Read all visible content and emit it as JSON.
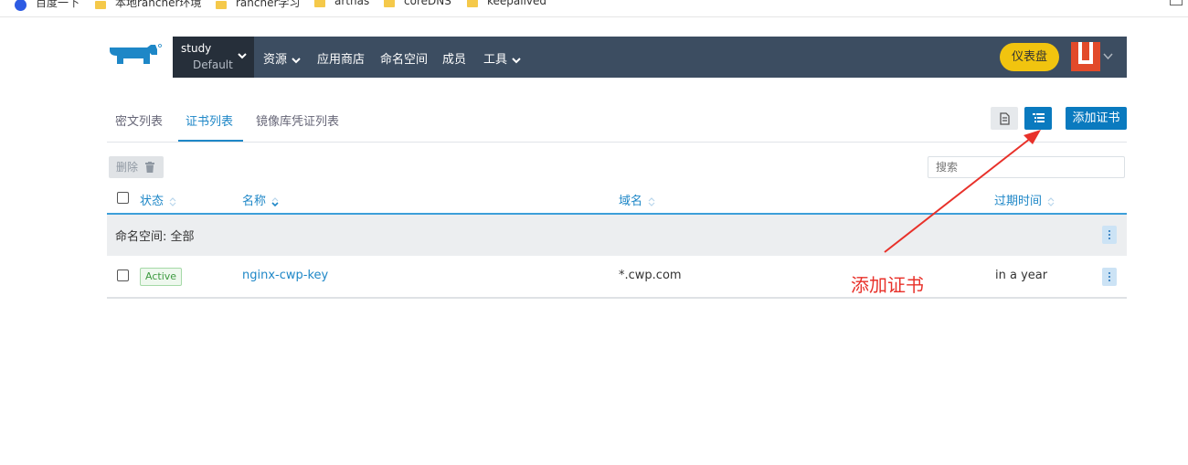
{
  "bookmarks": [
    {
      "label": "百度一下",
      "icon": "baidu-icon"
    },
    {
      "label": "本地rancher环境",
      "icon": "folder-icon"
    },
    {
      "label": "rancher学习",
      "icon": "folder-icon"
    },
    {
      "label": "arthas",
      "icon": "folder-icon"
    },
    {
      "label": "coreDNS",
      "icon": "folder-icon"
    },
    {
      "label": "keepalived",
      "icon": "folder-icon"
    }
  ],
  "nav": {
    "project_name": "study",
    "cluster_name": "Default",
    "items": [
      {
        "label": "资源",
        "has_dropdown": true
      },
      {
        "label": "应用商店",
        "has_dropdown": false
      },
      {
        "label": "命名空间",
        "has_dropdown": false
      },
      {
        "label": "成员",
        "has_dropdown": false
      },
      {
        "label": "工具",
        "has_dropdown": true
      }
    ],
    "dashboard_label": "仪表盘"
  },
  "tabs": [
    {
      "label": "密文列表",
      "active": false
    },
    {
      "label": "证书列表",
      "active": true
    },
    {
      "label": "镜像库凭证列表",
      "active": false
    }
  ],
  "toolbar": {
    "add_label": "添加证书",
    "delete_label": "删除",
    "search_placeholder": "搜索"
  },
  "table": {
    "headers": {
      "state": "状态",
      "name": "名称",
      "domain": "域名",
      "expires": "过期时间"
    },
    "group_label": "命名空间: 全部",
    "rows": [
      {
        "state": "Active",
        "name": "nginx-cwp-key",
        "domain": "*.cwp.com",
        "expires": "in a year"
      }
    ]
  },
  "annotation": {
    "label": "添加证书",
    "color": "#e8312a"
  },
  "colors": {
    "nav_bg": "#3c4d61",
    "project_bg": "#262f3a",
    "accent": "#1e87c7",
    "primary_button": "#0a7abf",
    "dashboard_button": "#f1c40f",
    "active_badge": "#3c9a3f"
  }
}
